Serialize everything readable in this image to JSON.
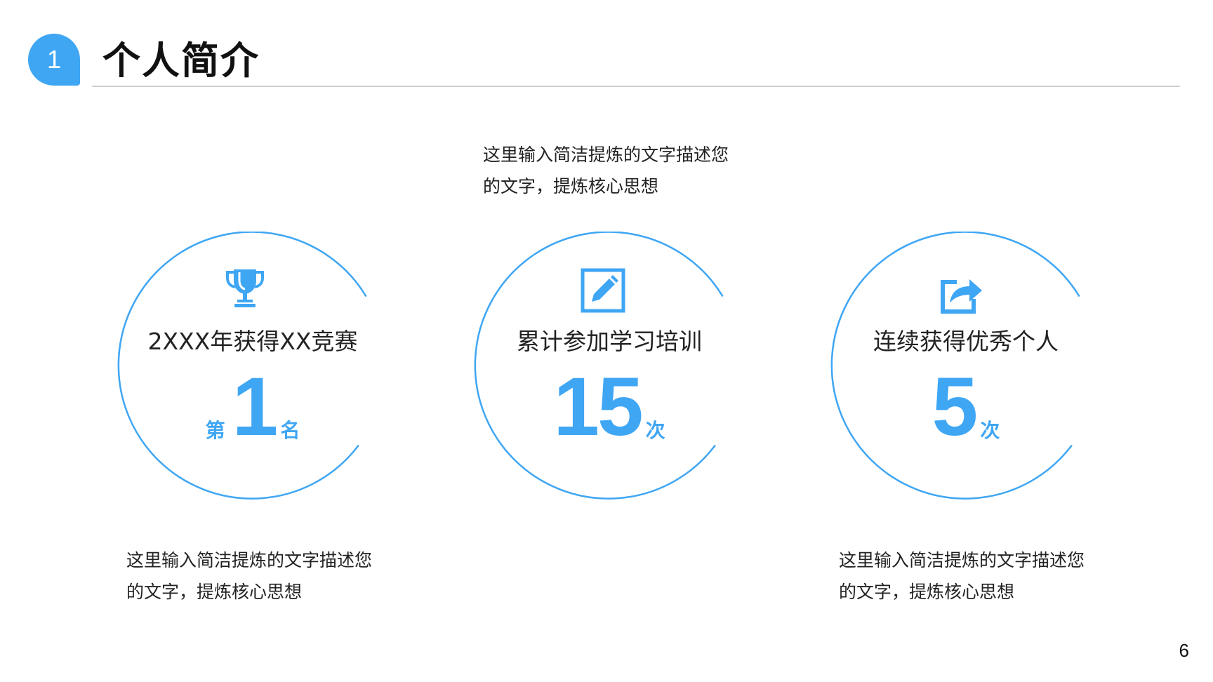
{
  "header": {
    "section_number": "1",
    "title": "个人简介"
  },
  "descriptions": [
    {
      "line1": "这里输入简洁提炼的文字描述您",
      "line2": "的文字，提炼核心思想"
    },
    {
      "line1": "这里输入简洁提炼的文字描述您",
      "line2": "的文字，提炼核心思想"
    },
    {
      "line1": "这里输入简洁提炼的文字描述您",
      "line2": "的文字，提炼核心思想"
    }
  ],
  "cards": [
    {
      "icon": "trophy-icon",
      "label": "2XXX年获得XX竞赛",
      "prefix": "第",
      "value": "1",
      "suffix": "名"
    },
    {
      "icon": "edit-icon",
      "label": "累计参加学习培训",
      "prefix": "",
      "value": "15",
      "suffix": "次"
    },
    {
      "icon": "share-icon",
      "label": "连续获得优秀个人",
      "prefix": "",
      "value": "5",
      "suffix": "次"
    }
  ],
  "colors": {
    "accent": "#3fa6f4",
    "rule": "#cfcfcf",
    "text": "#222222"
  },
  "page_number": "6"
}
